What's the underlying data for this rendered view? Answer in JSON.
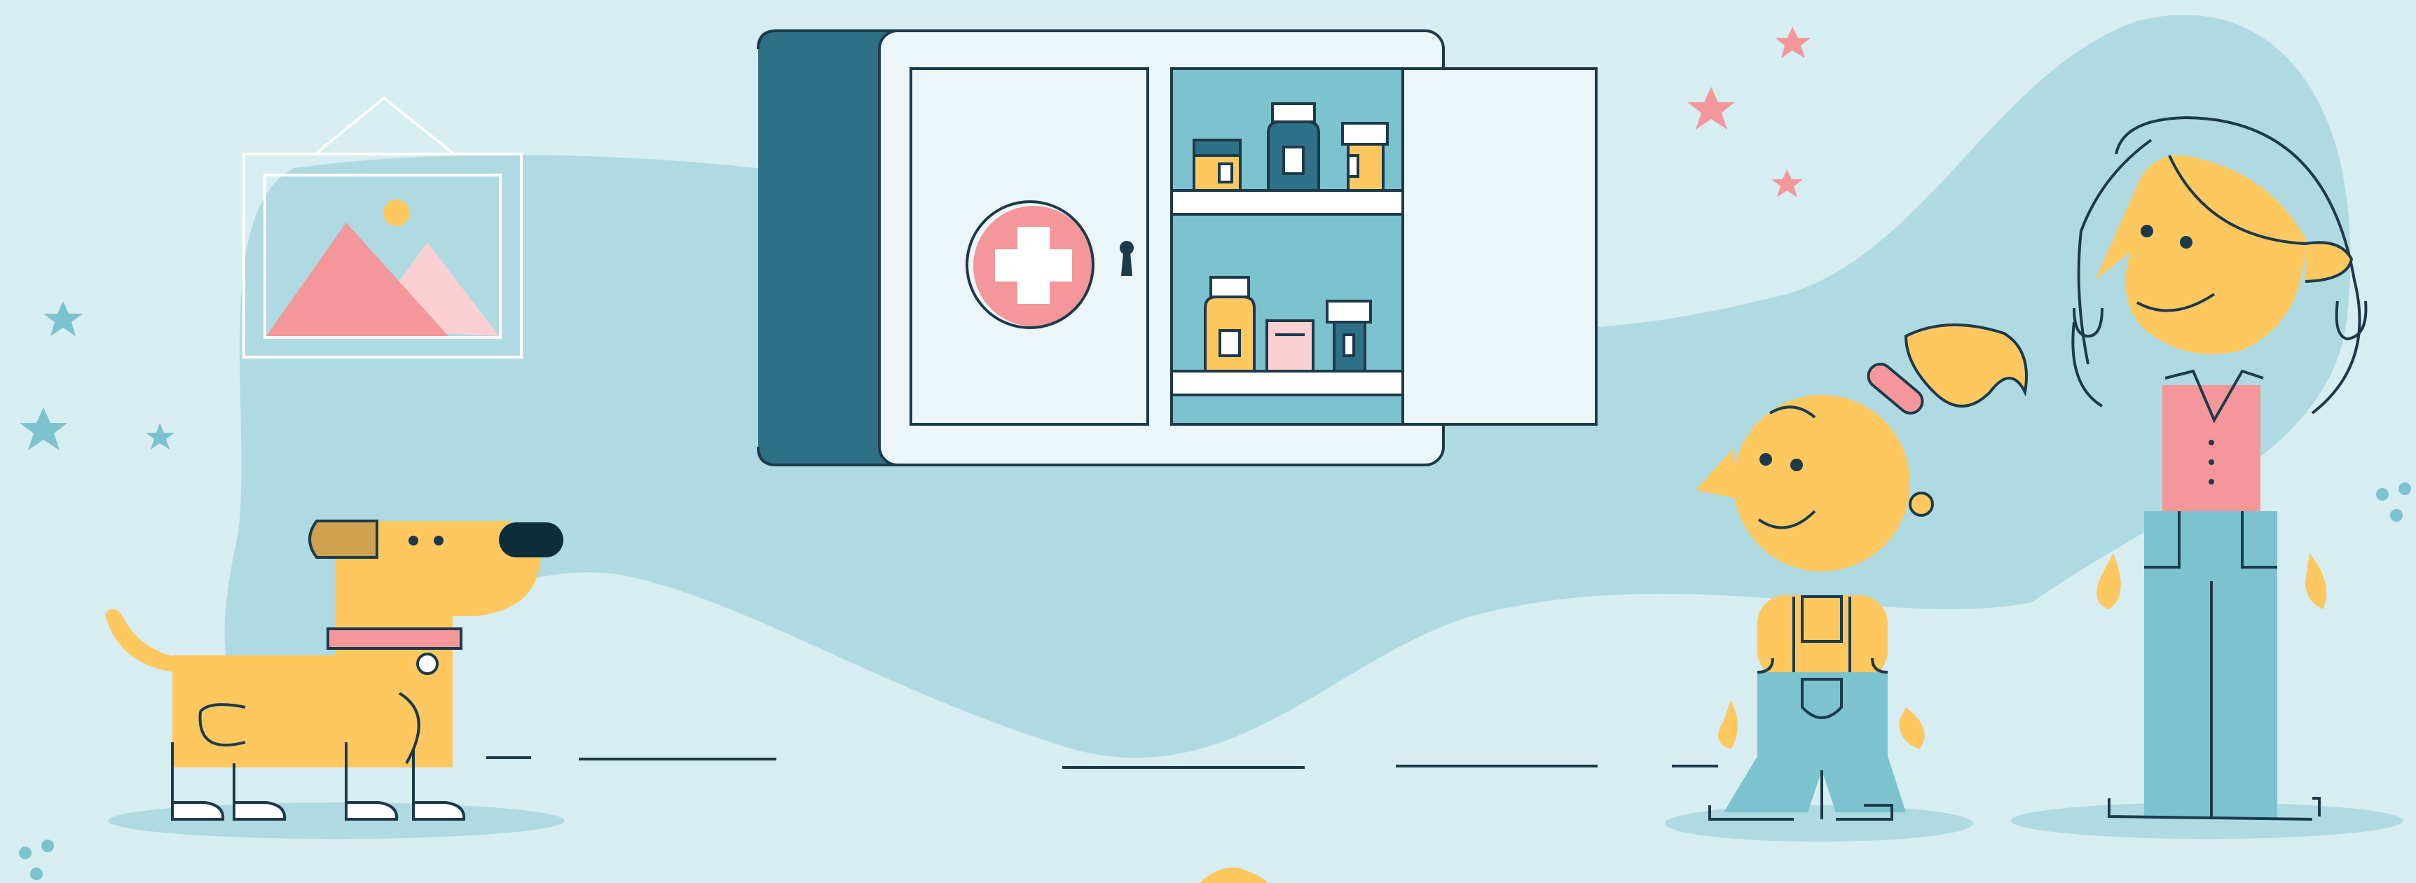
{
  "scene": {
    "subject": "illustration",
    "elements": [
      "dog",
      "framed-picture",
      "medicine-cabinet",
      "girl",
      "woman"
    ]
  },
  "palette": {
    "background": "#d6edf1",
    "blob": "#b0dae1",
    "outline": "#1d3a4b",
    "yellow": "#fdc860",
    "teal_dark": "#2e7186",
    "teal_light": "#7cc3cf",
    "pink": "#f3979a",
    "pink_light": "#fbd0d3",
    "white": "#ffffff",
    "off_white": "#ecf6f8"
  }
}
